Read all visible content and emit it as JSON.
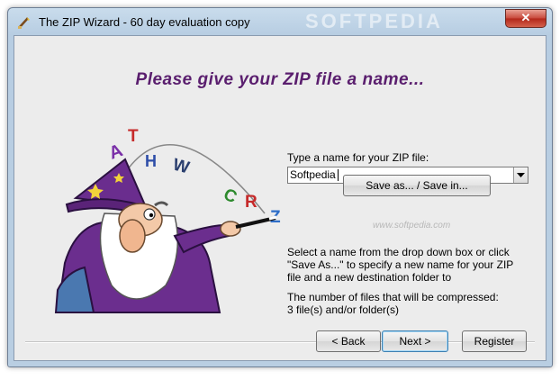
{
  "window": {
    "title": "The ZIP Wizard - 60 day evaluation copy",
    "watermark": "SOFTPEDIA",
    "close_label": "✕"
  },
  "page": {
    "heading": "Please give your ZIP file a name...",
    "prompt_label": "Type a name for your ZIP file:",
    "name_input": {
      "value": "Softpedia"
    },
    "save_as_label": "Save as... / Save in...",
    "watermark_small": "www.softpedia.com",
    "description": "Select a name from the drop down box or click \"Save As...\" to specify a new name for your ZIP file and a new destination folder to",
    "count_line1": "The number of files that will be compressed:",
    "count_line2": "3 file(s) and/or folder(s)"
  },
  "illustration": {
    "letters": [
      "A",
      "T",
      "H",
      "W",
      "C",
      "R",
      "Z"
    ]
  },
  "footer": {
    "back_label": "< Back",
    "next_label": "Next >",
    "register_label": "Register"
  }
}
